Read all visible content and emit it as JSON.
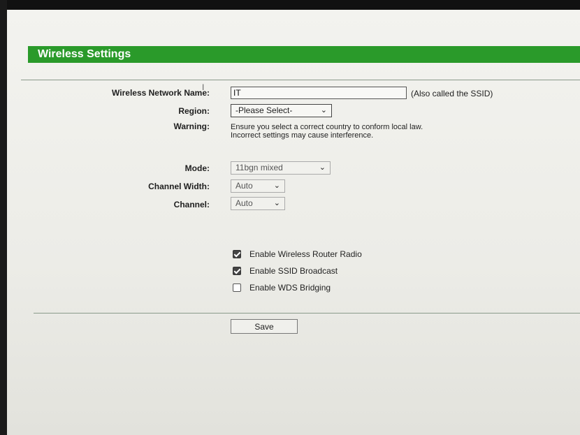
{
  "header": {
    "title": "Wireless Settings"
  },
  "form": {
    "ssid": {
      "label": "Wireless Network Name:",
      "value": "IT",
      "note": "(Also called the SSID)"
    },
    "region": {
      "label": "Region:",
      "value": "-Please Select-"
    },
    "warning": {
      "label": "Warning:",
      "line1": "Ensure you select a correct country to conform local law.",
      "line2": "Incorrect settings may cause interference."
    },
    "mode": {
      "label": "Mode:",
      "value": "11bgn mixed"
    },
    "channel_width": {
      "label": "Channel Width:",
      "value": "Auto"
    },
    "channel": {
      "label": "Channel:",
      "value": "Auto"
    }
  },
  "checkboxes": [
    {
      "label": "Enable Wireless Router Radio",
      "checked": true
    },
    {
      "label": "Enable SSID Broadcast",
      "checked": true
    },
    {
      "label": "Enable WDS Bridging",
      "checked": false
    }
  ],
  "save_label": "Save",
  "colors": {
    "header_bg": "#2a9a2a",
    "header_text": "#ffffff"
  },
  "icons": {
    "dropdown": "chevron-down-icon",
    "checked": "checkmark-icon",
    "cursor": "text-cursor-icon"
  }
}
